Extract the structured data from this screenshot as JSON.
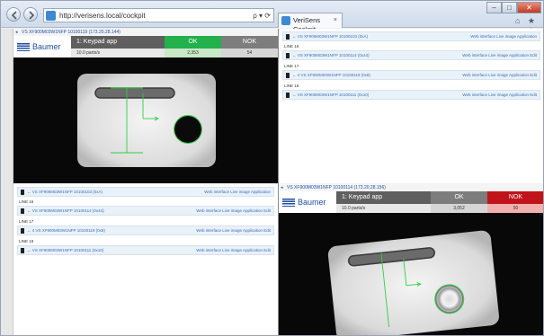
{
  "browser": {
    "address": "http://verisens.local/cockpit",
    "address_controls": "ρ ▾ ⟳",
    "tab_label": "VeriSens Cockpit",
    "tab_close": "×",
    "win_minimize": "–",
    "win_maximize": "□",
    "win_close": "✕",
    "toolbar_icons": "⌂ ★ ⚙"
  },
  "camera_top": {
    "title": "VS XF900M03W1NFP 10100119 (173.20.28.144)",
    "back": "◂",
    "app_name": "1: Keypad app",
    "app_status": "10.0 parts/s",
    "ok_label": "OK",
    "ok_count": "2,353",
    "nok_label": "NOK",
    "nok_count": "54"
  },
  "camera_bottom": {
    "title": "VS XF900M03W1NFP 10100114 (173.20.28.156)",
    "back": "◂",
    "app_name": "1: Keypad app",
    "app_status": "10.0 parts/s",
    "ok_label": "OK",
    "ok_count": "3,052",
    "nok_label": "NOK",
    "nok_count": "50"
  },
  "brand": {
    "word": "Baumer"
  },
  "list_tr": {
    "row0_link": "← VS XF900M03W1NFP 10100103 (0xA)",
    "row0_action": "Web interface  Live image  Application",
    "line1": "LINE 16",
    "row1_link": "← VS XF900M03W1NFP 10100114 (0x44)",
    "row1_action": "Web interface  Live image  Application  Edit",
    "line2": "LINE 17",
    "row2_link": "← 4 VS XF900M03W1NFP 10100119 (0x8)",
    "row2_action": "Web interface  Live image  Application  Edit",
    "line3": "LINE 18",
    "row3_link": "← VS XF900M03W1NFP 10100111 (0x10)",
    "row3_action": "Web interface  Live image  Application  Edit"
  },
  "list_bl": {
    "row0_link": "← VS XF900M03W1NFP 10100103 (0xA)",
    "row0_action": "Web interface  Live image  Application",
    "line1": "LINE 16",
    "row1_link": "← VS XF900M03W1NFP 10100114 (0x44)",
    "row1_action": "Web interface  Live image  Application  Edit",
    "line2": "LINE 17",
    "row2_link": "← 4 VS XF900M03W1NFP 10100119 (0x8)",
    "row2_action": "Web interface  Live image  Application  Edit",
    "line3": "LINE 18",
    "row3_link": "← VS XF900M03W1NFP 10100111 (0x10)",
    "row3_action": "Web interface  Live image  Application  Edit"
  },
  "colors": {
    "ok": "#22b14c",
    "nok": "#c0141a",
    "brand": "#1e4ea0",
    "overlay": "#2ed040"
  }
}
